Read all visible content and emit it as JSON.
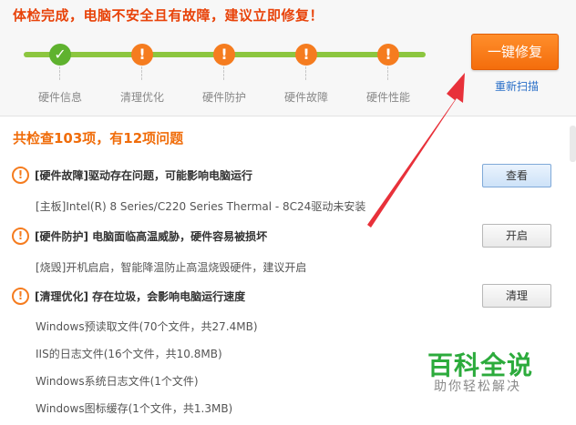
{
  "header": {
    "headline": "体检完成，电脑不安全且有故障，建议立即修复！",
    "fix_button": "一键修复",
    "rescan_link": "重新扫描"
  },
  "steps": [
    {
      "label": "硬件信息",
      "status": "ok",
      "icon": "check-icon"
    },
    {
      "label": "清理优化",
      "status": "warn",
      "icon": "exclamation-icon"
    },
    {
      "label": "硬件防护",
      "status": "warn",
      "icon": "exclamation-icon"
    },
    {
      "label": "硬件故障",
      "status": "warn",
      "icon": "exclamation-icon"
    },
    {
      "label": "硬件性能",
      "status": "warn",
      "icon": "exclamation-icon"
    }
  ],
  "summary": "共检查103项，有12项问题",
  "issues": [
    {
      "title": "[硬件故障]驱动存在问题，可能影响电脑运行",
      "button": "查看",
      "details": [
        "[主板]Intel(R) 8 Series/C220 Series Thermal - 8C24驱动未安装"
      ]
    },
    {
      "title": "[硬件防护] 电脑面临高温威胁，硬件容易被损坏",
      "button": "开启",
      "details": [
        "[烧毁]开机启启，智能降温防止高温烧毁硬件，建议开启"
      ]
    },
    {
      "title": "[清理优化] 存在垃圾，会影响电脑运行速度",
      "button": "清理",
      "details": [
        "Windows预读取文件(70个文件，共27.4MB)",
        "IIS的日志文件(16个文件，共10.8MB)",
        "Windows系统日志文件(1个文件)",
        "Windows图标缓存(1个文件，共1.3MB)"
      ]
    }
  ],
  "watermark": {
    "main": "百科全说",
    "sub": "助你轻松解决"
  },
  "colors": {
    "accent": "#f57c1f",
    "ok": "#5fb22f",
    "track": "#8cc63f",
    "link": "#2a6fc8",
    "arrow": "#e8313a"
  }
}
